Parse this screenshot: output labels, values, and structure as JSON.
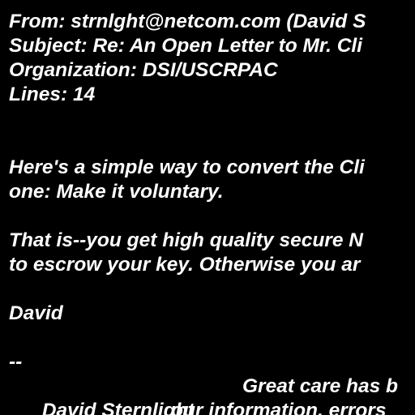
{
  "headers": {
    "from": "From: strnlght@netcom.com (David S",
    "subject": "Subject: Re: An Open Letter to Mr. Cli",
    "organization": "Organization: DSI/USCRPAC",
    "lines": "Lines: 14"
  },
  "body": {
    "para1_line1": "Here's a simple way to convert the Cli",
    "para1_line2": "one: Make it voluntary.",
    "para2_line1": "That is--you get high quality secure N",
    "para2_line2": "to escrow your key. Otherwise you ar",
    "signoff": "David"
  },
  "signature": {
    "separator": "--",
    "name": "David Sternlight",
    "disclaimer_line1": "Great care has b",
    "disclaimer_line2": "our information, errors"
  },
  "colors": {
    "background": "#000000",
    "text": "#ffffff"
  }
}
